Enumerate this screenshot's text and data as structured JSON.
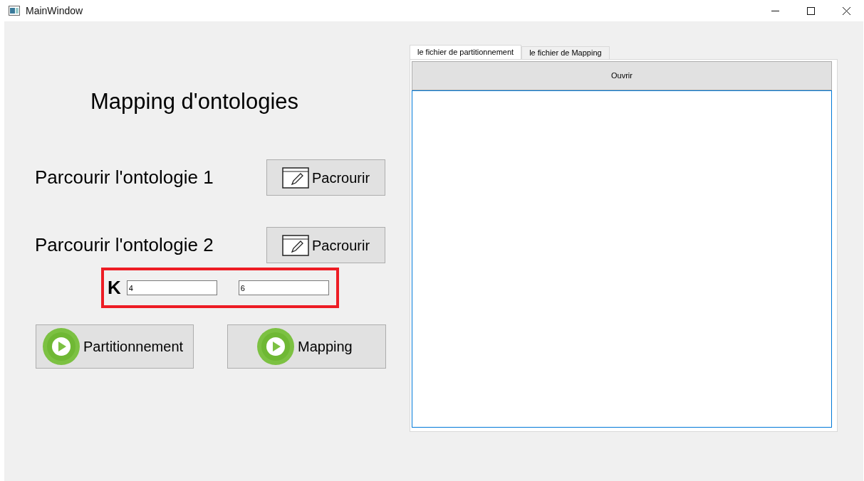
{
  "window": {
    "title": "MainWindow"
  },
  "heading": "Mapping d'ontologies",
  "browse_rows": [
    {
      "label": "Parcourir l'ontologie 1",
      "button": "Pacrourir"
    },
    {
      "label": "Parcourir l'ontologie 2",
      "button": "Pacrourir"
    }
  ],
  "k_group": {
    "label": "K",
    "fields": [
      {
        "value": "4"
      },
      {
        "value": "6"
      }
    ]
  },
  "action_buttons": [
    "Partitionnement",
    "Mapping"
  ],
  "tabs": [
    {
      "label": "le fichier de partitionnement",
      "selected": true
    },
    {
      "label": "le fichier de Mapping",
      "selected": false
    }
  ],
  "open_button": "Ouvrir"
}
